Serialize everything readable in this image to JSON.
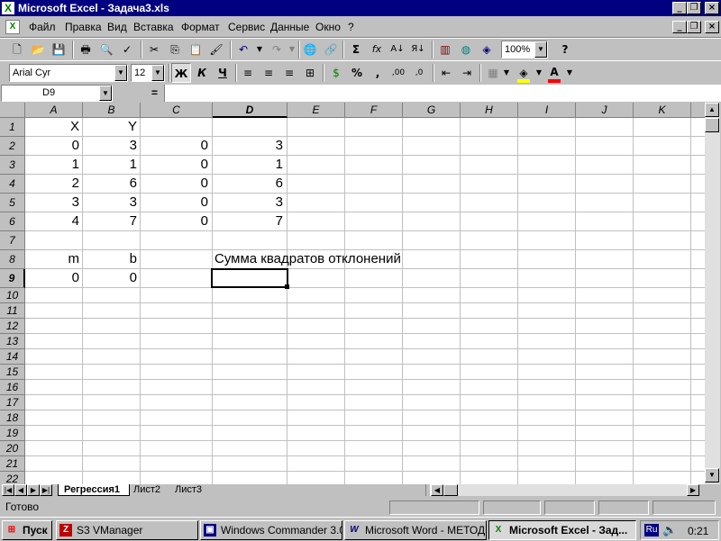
{
  "window": {
    "title": "Microsoft Excel - Задача3.xls"
  },
  "menu": {
    "items": [
      "Файл",
      "Правка",
      "Вид",
      "Вставка",
      "Формат",
      "Сервис",
      "Данные",
      "Окно",
      "?"
    ]
  },
  "toolbar": {
    "zoom": "100%",
    "font_name": "Arial Cyr",
    "font_size": "12",
    "bold_label": "Ж",
    "italic_label": "К",
    "underline_label": "Ч",
    "percent_label": "%",
    "comma_label": ",",
    "sum_label": "Σ",
    "fx_label": "fx"
  },
  "formula": {
    "name_box": "D9",
    "equals": "=",
    "content": ""
  },
  "columns": [
    "A",
    "B",
    "C",
    "D",
    "E",
    "F",
    "G",
    "H",
    "I",
    "J",
    "K"
  ],
  "rows": [
    "1",
    "2",
    "3",
    "4",
    "5",
    "6",
    "7",
    "8",
    "9",
    "10",
    "11",
    "12",
    "13",
    "14",
    "15",
    "16",
    "17",
    "18",
    "19",
    "20",
    "21",
    "22"
  ],
  "cells": {
    "A1": "X",
    "B1": "Y",
    "A2": "0",
    "B2": "3",
    "C2": "0",
    "D2": "3",
    "A3": "1",
    "B3": "1",
    "C3": "0",
    "D3": "1",
    "A4": "2",
    "B4": "6",
    "C4": "0",
    "D4": "6",
    "A5": "3",
    "B5": "3",
    "C5": "0",
    "D5": "3",
    "A6": "4",
    "B6": "7",
    "C6": "0",
    "D6": "7",
    "A8": "m",
    "B8": "b",
    "D8": "Сумма квадратов отклонений",
    "A9": "0",
    "B9": "0"
  },
  "active_cell": "D9",
  "sheets": [
    "Регрессия1",
    "Лист2",
    "Лист3"
  ],
  "active_sheet": "Регрессия1",
  "status": {
    "text": "Готово"
  },
  "taskbar": {
    "start_label": "Пуск",
    "items": [
      "S3 VManager",
      "Windows Commander 3.0...",
      "Microsoft Word - МЕТОД...",
      "Microsoft Excel - Зад..."
    ],
    "lang": "Ru",
    "clock": "0:21"
  }
}
